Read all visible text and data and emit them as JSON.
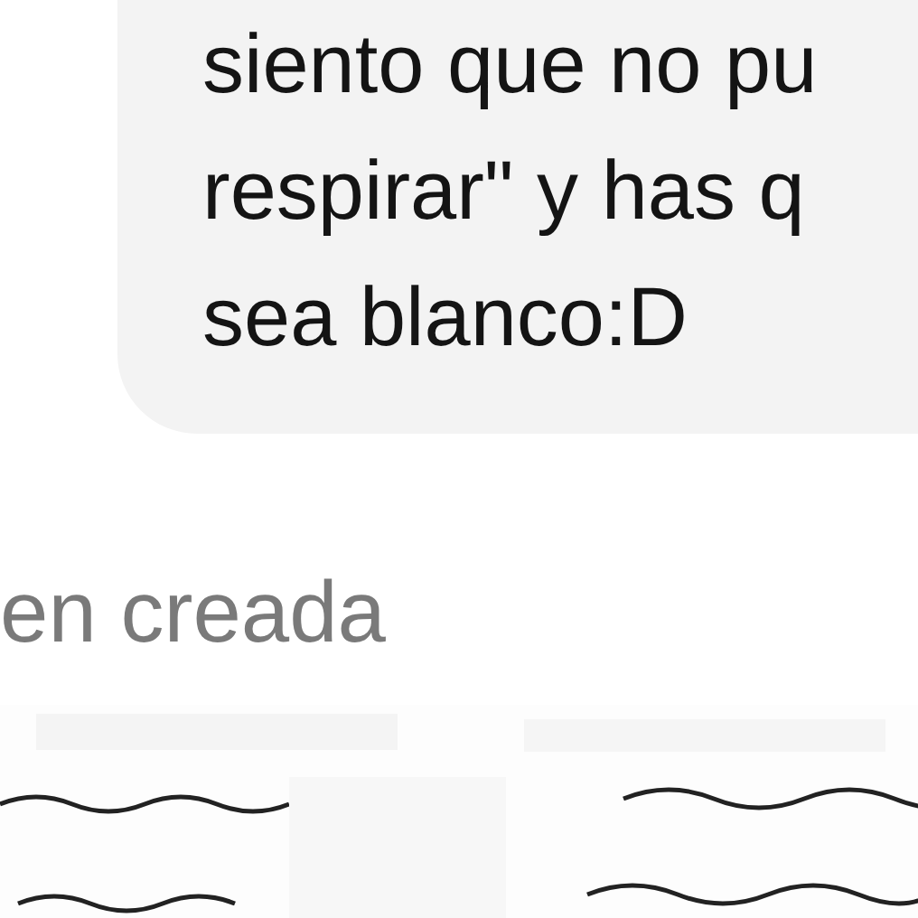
{
  "message": {
    "lines": [
      "siento que no pu",
      "respirar\" y has q",
      "sea blanco:D"
    ]
  },
  "image_caption": "en creada"
}
